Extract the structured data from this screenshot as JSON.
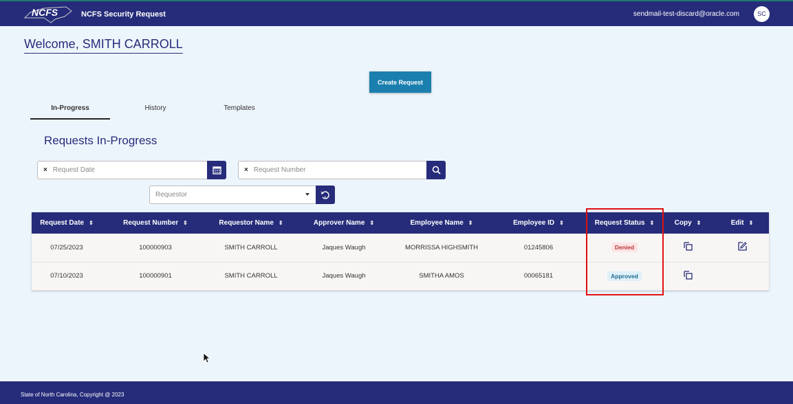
{
  "header": {
    "app_title": "NCFS Security Request",
    "logo_text": "NCFS",
    "email": "sendmail-test-discard@oracle.com",
    "avatar_initials": "SC"
  },
  "welcome": "Welcome, SMITH CARROLL",
  "create_button": "Create Request",
  "tabs": [
    {
      "label": "In-Progress",
      "active": true
    },
    {
      "label": "History"
    },
    {
      "label": "Templates"
    }
  ],
  "section_title": "Requests In-Progress",
  "filters": {
    "request_date_placeholder": "Request Date",
    "request_number_placeholder": "Request Number",
    "requestor_placeholder": "Requestor",
    "clear": "×"
  },
  "table": {
    "headers": [
      "Request Date",
      "Request Number",
      "Requestor Name",
      "Approver Name",
      "Employee Name",
      "Employee ID",
      "Request Status",
      "Copy",
      "Edit"
    ],
    "rows": [
      {
        "date": "07/25/2023",
        "number": "100000903",
        "requestor": "SMITH CARROLL",
        "approver": "Jaques Waugh",
        "employee": "MORRISSA HIGHSMITH",
        "employee_id": "01245806",
        "status": "Denied",
        "editable": true
      },
      {
        "date": "07/10/2023",
        "number": "100000901",
        "requestor": "SMITH CARROLL",
        "approver": "Jaques Waugh",
        "employee": "SMITHA AMOS",
        "employee_id": "00065181",
        "status": "Approved",
        "editable": false
      }
    ]
  },
  "footer": "State of North Carolina, Copyright @ 2023"
}
